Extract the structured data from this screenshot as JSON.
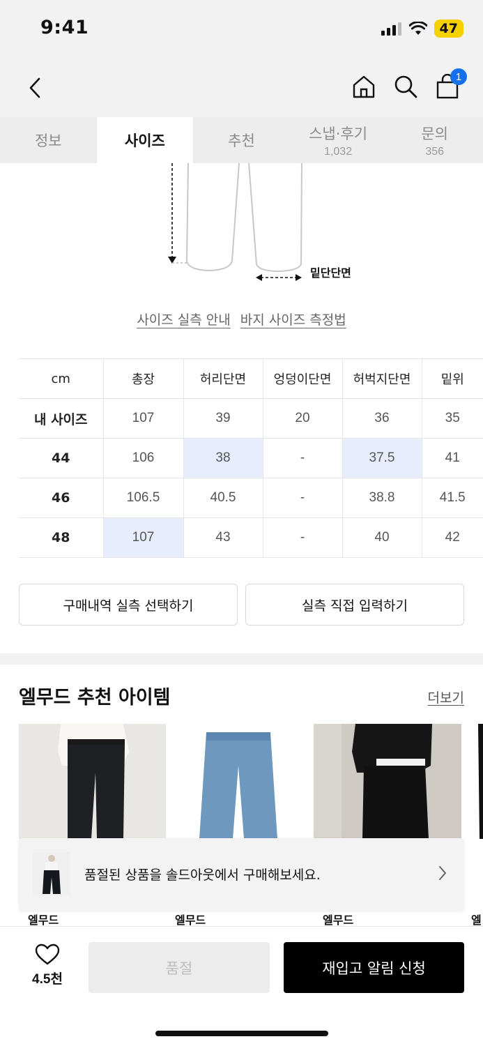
{
  "status": {
    "time": "9:41",
    "battery": "47"
  },
  "header": {
    "cart_count": "1"
  },
  "tabs": [
    {
      "label": "정보",
      "count": ""
    },
    {
      "label": "사이즈",
      "count": ""
    },
    {
      "label": "추천",
      "count": ""
    },
    {
      "label": "스냅·후기",
      "count": "1,032"
    },
    {
      "label": "문의",
      "count": "356"
    }
  ],
  "illustration": {
    "hem_label": "밑단단면"
  },
  "guide_links": {
    "size_guide": "사이즈 실측 안내",
    "pants_measure": "바지 사이즈 측정법"
  },
  "size_table": {
    "headers": [
      "cm",
      "총장",
      "허리단면",
      "엉덩이단면",
      "허벅지단면",
      "밑위"
    ],
    "rows": [
      {
        "label": "내 사이즈",
        "values": [
          "107",
          "39",
          "20",
          "36",
          "35"
        ]
      },
      {
        "label": "44",
        "values": [
          "106",
          "38",
          "-",
          "37.5",
          "41"
        ]
      },
      {
        "label": "46",
        "values": [
          "106.5",
          "40.5",
          "-",
          "38.8",
          "41.5"
        ]
      },
      {
        "label": "48",
        "values": [
          "107",
          "43",
          "-",
          "40",
          "42"
        ]
      }
    ]
  },
  "actions": {
    "purchase_history": "구매내역 실측 선택하기",
    "direct_input": "실측 직접 입력하기"
  },
  "recommend": {
    "title": "엘무드 추천 아이템",
    "more": "더보기",
    "brands": [
      "엘무드",
      "엘무드",
      "엘무드",
      "엘"
    ]
  },
  "toast": {
    "text": "품절된 상품을 솔드아웃에서 구매해보세요."
  },
  "bottom": {
    "like_count": "4.5천",
    "soldout": "품절",
    "restock": "재입고 알림 신청"
  }
}
